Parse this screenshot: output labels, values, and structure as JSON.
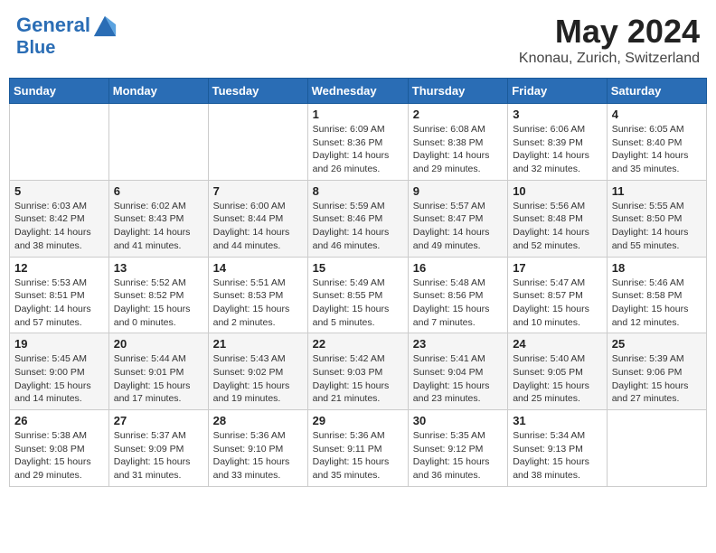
{
  "header": {
    "logo_line1": "General",
    "logo_line2": "Blue",
    "title": "May 2024",
    "subtitle": "Knonau, Zurich, Switzerland"
  },
  "days_of_week": [
    "Sunday",
    "Monday",
    "Tuesday",
    "Wednesday",
    "Thursday",
    "Friday",
    "Saturday"
  ],
  "weeks": [
    [
      {
        "day": "",
        "info": ""
      },
      {
        "day": "",
        "info": ""
      },
      {
        "day": "",
        "info": ""
      },
      {
        "day": "1",
        "info": "Sunrise: 6:09 AM\nSunset: 8:36 PM\nDaylight: 14 hours and 26 minutes."
      },
      {
        "day": "2",
        "info": "Sunrise: 6:08 AM\nSunset: 8:38 PM\nDaylight: 14 hours and 29 minutes."
      },
      {
        "day": "3",
        "info": "Sunrise: 6:06 AM\nSunset: 8:39 PM\nDaylight: 14 hours and 32 minutes."
      },
      {
        "day": "4",
        "info": "Sunrise: 6:05 AM\nSunset: 8:40 PM\nDaylight: 14 hours and 35 minutes."
      }
    ],
    [
      {
        "day": "5",
        "info": "Sunrise: 6:03 AM\nSunset: 8:42 PM\nDaylight: 14 hours and 38 minutes."
      },
      {
        "day": "6",
        "info": "Sunrise: 6:02 AM\nSunset: 8:43 PM\nDaylight: 14 hours and 41 minutes."
      },
      {
        "day": "7",
        "info": "Sunrise: 6:00 AM\nSunset: 8:44 PM\nDaylight: 14 hours and 44 minutes."
      },
      {
        "day": "8",
        "info": "Sunrise: 5:59 AM\nSunset: 8:46 PM\nDaylight: 14 hours and 46 minutes."
      },
      {
        "day": "9",
        "info": "Sunrise: 5:57 AM\nSunset: 8:47 PM\nDaylight: 14 hours and 49 minutes."
      },
      {
        "day": "10",
        "info": "Sunrise: 5:56 AM\nSunset: 8:48 PM\nDaylight: 14 hours and 52 minutes."
      },
      {
        "day": "11",
        "info": "Sunrise: 5:55 AM\nSunset: 8:50 PM\nDaylight: 14 hours and 55 minutes."
      }
    ],
    [
      {
        "day": "12",
        "info": "Sunrise: 5:53 AM\nSunset: 8:51 PM\nDaylight: 14 hours and 57 minutes."
      },
      {
        "day": "13",
        "info": "Sunrise: 5:52 AM\nSunset: 8:52 PM\nDaylight: 15 hours and 0 minutes."
      },
      {
        "day": "14",
        "info": "Sunrise: 5:51 AM\nSunset: 8:53 PM\nDaylight: 15 hours and 2 minutes."
      },
      {
        "day": "15",
        "info": "Sunrise: 5:49 AM\nSunset: 8:55 PM\nDaylight: 15 hours and 5 minutes."
      },
      {
        "day": "16",
        "info": "Sunrise: 5:48 AM\nSunset: 8:56 PM\nDaylight: 15 hours and 7 minutes."
      },
      {
        "day": "17",
        "info": "Sunrise: 5:47 AM\nSunset: 8:57 PM\nDaylight: 15 hours and 10 minutes."
      },
      {
        "day": "18",
        "info": "Sunrise: 5:46 AM\nSunset: 8:58 PM\nDaylight: 15 hours and 12 minutes."
      }
    ],
    [
      {
        "day": "19",
        "info": "Sunrise: 5:45 AM\nSunset: 9:00 PM\nDaylight: 15 hours and 14 minutes."
      },
      {
        "day": "20",
        "info": "Sunrise: 5:44 AM\nSunset: 9:01 PM\nDaylight: 15 hours and 17 minutes."
      },
      {
        "day": "21",
        "info": "Sunrise: 5:43 AM\nSunset: 9:02 PM\nDaylight: 15 hours and 19 minutes."
      },
      {
        "day": "22",
        "info": "Sunrise: 5:42 AM\nSunset: 9:03 PM\nDaylight: 15 hours and 21 minutes."
      },
      {
        "day": "23",
        "info": "Sunrise: 5:41 AM\nSunset: 9:04 PM\nDaylight: 15 hours and 23 minutes."
      },
      {
        "day": "24",
        "info": "Sunrise: 5:40 AM\nSunset: 9:05 PM\nDaylight: 15 hours and 25 minutes."
      },
      {
        "day": "25",
        "info": "Sunrise: 5:39 AM\nSunset: 9:06 PM\nDaylight: 15 hours and 27 minutes."
      }
    ],
    [
      {
        "day": "26",
        "info": "Sunrise: 5:38 AM\nSunset: 9:08 PM\nDaylight: 15 hours and 29 minutes."
      },
      {
        "day": "27",
        "info": "Sunrise: 5:37 AM\nSunset: 9:09 PM\nDaylight: 15 hours and 31 minutes."
      },
      {
        "day": "28",
        "info": "Sunrise: 5:36 AM\nSunset: 9:10 PM\nDaylight: 15 hours and 33 minutes."
      },
      {
        "day": "29",
        "info": "Sunrise: 5:36 AM\nSunset: 9:11 PM\nDaylight: 15 hours and 35 minutes."
      },
      {
        "day": "30",
        "info": "Sunrise: 5:35 AM\nSunset: 9:12 PM\nDaylight: 15 hours and 36 minutes."
      },
      {
        "day": "31",
        "info": "Sunrise: 5:34 AM\nSunset: 9:13 PM\nDaylight: 15 hours and 38 minutes."
      },
      {
        "day": "",
        "info": ""
      }
    ]
  ]
}
